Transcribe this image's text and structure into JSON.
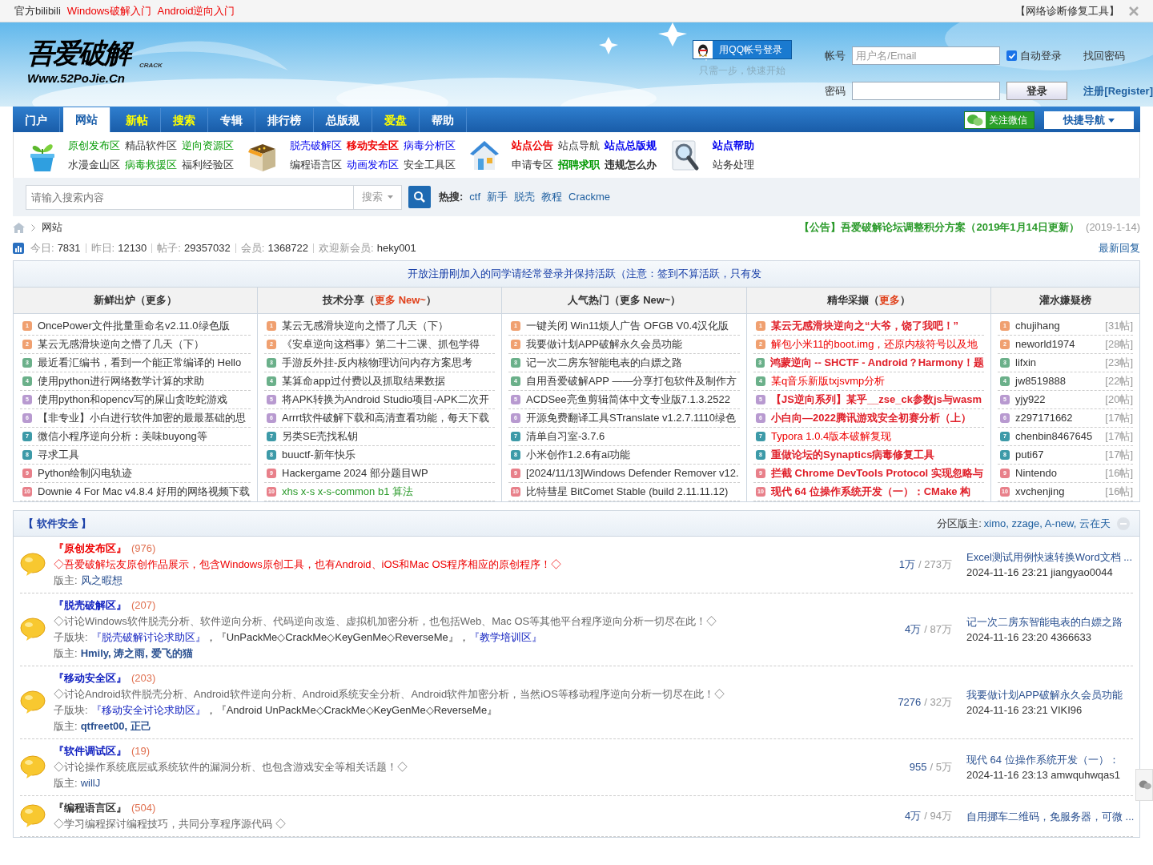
{
  "top_bar": {
    "links": [
      {
        "text": "官方bilibili",
        "kind": "plain"
      },
      {
        "text": "Windows破解入门",
        "kind": "red"
      },
      {
        "text": "Android逆向入门",
        "kind": "red"
      }
    ],
    "tool": "【网络诊断修复工具】"
  },
  "header": {
    "logo": {
      "title": "吾爱破解",
      "tag": "CRACK",
      "url": "Www.52PoJie.Cn"
    },
    "qq_button": "用QQ帐号登录",
    "qq_hint": "只需一步，快速开始",
    "account_label": "帐号",
    "account_placeholder": "用户名/Email",
    "auto_login": {
      "label": "自动登录",
      "checked": true
    },
    "forgot": "找回密码",
    "password_label": "密码",
    "login_button": "登录",
    "register": "注册[Register]"
  },
  "nav": {
    "tabs": [
      {
        "label": "门户",
        "selected": false,
        "highlight": false
      },
      {
        "label": "网站",
        "selected": true,
        "highlight": false
      },
      {
        "label": "新帖",
        "selected": false,
        "highlight": true
      },
      {
        "label": "搜索",
        "selected": false,
        "highlight": true
      },
      {
        "label": "专辑",
        "selected": false,
        "highlight": false
      },
      {
        "label": "排行榜",
        "selected": false,
        "highlight": false
      },
      {
        "label": "总版规",
        "selected": false,
        "highlight": false
      },
      {
        "label": "爱盘",
        "selected": false,
        "highlight": true
      },
      {
        "label": "帮助",
        "selected": false,
        "highlight": false
      }
    ],
    "wechat": "关注微信",
    "quick_nav": "快捷导航"
  },
  "quick_links": [
    {
      "kind": "plant",
      "rows": [
        [
          {
            "text": "原创发布区",
            "kind": "green",
            "bold": false
          },
          {
            "text": "精品软件区",
            "kind": "plain",
            "bold": false
          },
          {
            "text": "逆向资源区",
            "kind": "green",
            "bold": false
          }
        ],
        [
          {
            "text": "水漫金山区",
            "kind": "plain",
            "bold": false
          },
          {
            "text": "病毒救援区",
            "kind": "green",
            "bold": false
          },
          {
            "text": "福利经验区",
            "kind": "plain",
            "bold": false
          }
        ]
      ]
    },
    {
      "kind": "box",
      "rows": [
        [
          {
            "text": "脱壳破解区",
            "kind": "blue",
            "bold": false
          },
          {
            "text": "移动安全区",
            "kind": "red",
            "bold": true
          },
          {
            "text": "病毒分析区",
            "kind": "blue",
            "bold": false
          }
        ],
        [
          {
            "text": "编程语言区",
            "kind": "plain",
            "bold": false
          },
          {
            "text": "动画发布区",
            "kind": "blue",
            "bold": false
          },
          {
            "text": "安全工具区",
            "kind": "plain",
            "bold": false
          }
        ]
      ]
    },
    {
      "kind": "house",
      "rows": [
        [
          {
            "text": "站点公告",
            "kind": "red",
            "bold": true
          },
          {
            "text": "站点导航",
            "kind": "plain",
            "bold": false
          },
          {
            "text": "站点总版规",
            "kind": "blue",
            "bold": true
          }
        ],
        [
          {
            "text": "申请专区",
            "kind": "plain",
            "bold": false
          },
          {
            "text": "招聘求职",
            "kind": "green",
            "bold": true
          },
          {
            "text": "违规怎么办",
            "kind": "plain",
            "bold": true
          }
        ]
      ]
    },
    {
      "kind": "magnifier",
      "rows": [
        [
          {
            "text": "站点帮助",
            "kind": "blue",
            "bold": true
          }
        ],
        [
          {
            "text": "站务处理",
            "kind": "plain",
            "bold": false
          }
        ]
      ]
    }
  ],
  "search": {
    "placeholder": "请输入搜索内容",
    "scope": "搜索",
    "hot_label": "热搜:",
    "hot": [
      "ctf",
      "新手",
      "脱壳",
      "教程",
      "Crackme"
    ]
  },
  "breadcrumb": {
    "current": "网站",
    "notice": "【公告】吾爱破解论坛调整积分方案（2019年1月14日更新）",
    "notice_date": "(2019-1-14)"
  },
  "stats": {
    "items": [
      {
        "label": "今日:",
        "value": "7831"
      },
      {
        "label": "昨日:",
        "value": "12130"
      },
      {
        "label": "帖子:",
        "value": "29357032"
      },
      {
        "label": "会员:",
        "value": "1368722"
      },
      {
        "label": "欢迎新会员:",
        "value": "heky001"
      }
    ],
    "latest": "最新回复"
  },
  "announcement": "开放注册刚加入的同学请经常登录并保持活跃（注意：签到不算活跃，只有发",
  "hot_table": [
    {
      "before": "新鲜出炉（",
      "more": "更多",
      "after": "）",
      "highlight": false,
      "items": [
        {
          "rank": "1",
          "title": "OncePower文件批量重命名v2.11.0绿色版",
          "kind": "plain"
        },
        {
          "rank": "2",
          "title": "某云无感滑块逆向之懵了几天（下）",
          "kind": "plain"
        },
        {
          "rank": "3",
          "title": "最近看汇编书，看到一个能正常编译的 Hello",
          "kind": "plain"
        },
        {
          "rank": "4",
          "title": "使用python进行网络数学计算的求助",
          "kind": "plain"
        },
        {
          "rank": "5",
          "title": "使用python和opencv写的屎山贪吃蛇游戏",
          "kind": "plain"
        },
        {
          "rank": "6",
          "title": "【非专业】小白进行软件加密的最最基础的思",
          "kind": "plain"
        },
        {
          "rank": "7",
          "title": "微信小程序逆向分析：美味buyong等",
          "kind": "plain"
        },
        {
          "rank": "8",
          "title": "寻求工具",
          "kind": "plain"
        },
        {
          "rank": "9",
          "title": "Python绘制闪电轨迹",
          "kind": "plain"
        },
        {
          "rank": "10",
          "title": "Downie 4 For Mac v4.8.4 好用的网络视频下载",
          "kind": "plain"
        }
      ]
    },
    {
      "before": "技术分享（",
      "more": "更多 New~",
      "after": "）",
      "highlight": true,
      "items": [
        {
          "rank": "1",
          "title": "某云无感滑块逆向之懵了几天（下）",
          "kind": "plain"
        },
        {
          "rank": "2",
          "title": "《安卓逆向这档事》第二十二课、抓包学得",
          "kind": "plain"
        },
        {
          "rank": "3",
          "title": "手游反外挂-反内核物理访问内存方案思考",
          "kind": "plain"
        },
        {
          "rank": "4",
          "title": "某算命app过付费以及抓取结果数据",
          "kind": "plain"
        },
        {
          "rank": "5",
          "title": "将APK转换为Android Studio项目-APK二次开",
          "kind": "plain"
        },
        {
          "rank": "6",
          "title": "Arrrt软件破解下载和高清查看功能，每天下载",
          "kind": "plain"
        },
        {
          "rank": "7",
          "title": "另类SE壳找私钥",
          "kind": "plain"
        },
        {
          "rank": "8",
          "title": "buuctf-新年快乐",
          "kind": "plain"
        },
        {
          "rank": "9",
          "title": "Hackergame 2024 部分题目WP",
          "kind": "plain"
        },
        {
          "rank": "10",
          "title": "xhs x-s x-s-common b1 算法",
          "kind": "green"
        }
      ]
    },
    {
      "before": "人气热门（",
      "more": "更多 New~",
      "after": "）",
      "highlight": false,
      "items": [
        {
          "rank": "1",
          "title": "一键关闭 Win11烦人广告 OFGB V0.4汉化版",
          "kind": "plain"
        },
        {
          "rank": "2",
          "title": "我要做计划APP破解永久会员功能",
          "kind": "plain"
        },
        {
          "rank": "3",
          "title": "记一次二房东智能电表的白嫖之路",
          "kind": "plain"
        },
        {
          "rank": "4",
          "title": "自用吾爱破解APP ——分享打包软件及制作方",
          "kind": "plain"
        },
        {
          "rank": "5",
          "title": "ACDSee亮鱼剪辑简体中文专业版7.1.3.2522",
          "kind": "plain"
        },
        {
          "rank": "6",
          "title": "开源免费翻译工具STranslate v1.2.7.1110绿色",
          "kind": "plain"
        },
        {
          "rank": "7",
          "title": "清单自习室-3.7.6",
          "kind": "plain"
        },
        {
          "rank": "8",
          "title": "小米创作1.2.6有ai功能",
          "kind": "plain"
        },
        {
          "rank": "9",
          "title": "[2024/11/13]Windows Defender Remover v12.",
          "kind": "plain"
        },
        {
          "rank": "10",
          "title": "比特彗星 BitComet Stable (build 2.11.11.12)",
          "kind": "plain"
        }
      ]
    },
    {
      "before": "精华采撷（",
      "more": "更多",
      "after": "）",
      "highlight": true,
      "items": [
        {
          "rank": "1",
          "title": "某云无感滑块逆向之“大爷，饶了我吧！”",
          "kind": "red-bold"
        },
        {
          "rank": "2",
          "title": "解包小米11的boot.img，还原内核符号以及地",
          "kind": "red"
        },
        {
          "rank": "3",
          "title": "鸿蒙逆向 -- SHCTF - Android？Harmony！题",
          "kind": "red-bold"
        },
        {
          "rank": "4",
          "title": "某q音乐新版txjsvmp分析",
          "kind": "red"
        },
        {
          "rank": "5",
          "title": "【JS逆向系列】某乎__zse_ck参数js与wasm",
          "kind": "red-bold"
        },
        {
          "rank": "6",
          "title": "小白向—2022腾讯游戏安全初赛分析（上）",
          "kind": "red-bold"
        },
        {
          "rank": "7",
          "title": "Typora 1.0.4版本破解复现",
          "kind": "red"
        },
        {
          "rank": "8",
          "title": "重做论坛的Synaptics病毒修复工具",
          "kind": "red-bold"
        },
        {
          "rank": "9",
          "title": "拦截 Chrome DevTools Protocol 实现忽略与",
          "kind": "red-bold"
        },
        {
          "rank": "10",
          "title": "现代 64 位操作系统开发（一）：CMake 构",
          "kind": "red-bold"
        }
      ]
    },
    {
      "before": "灌水嫌疑榜",
      "items": [
        {
          "rank": "1",
          "title": "chujihang",
          "count": "[31帖]",
          "kind": "plain"
        },
        {
          "rank": "2",
          "title": "neworld1974",
          "count": "[28帖]",
          "kind": "plain"
        },
        {
          "rank": "3",
          "title": "lifxin",
          "count": "[23帖]",
          "kind": "plain"
        },
        {
          "rank": "4",
          "title": "jw8519888",
          "count": "[22帖]",
          "kind": "plain"
        },
        {
          "rank": "5",
          "title": "yjy922",
          "count": "[20帖]",
          "kind": "plain"
        },
        {
          "rank": "6",
          "title": "z297171662",
          "count": "[17帖]",
          "kind": "plain"
        },
        {
          "rank": "7",
          "title": "chenbin8467645",
          "count": "[17帖]",
          "kind": "plain"
        },
        {
          "rank": "8",
          "title": "puti67",
          "count": "[17帖]",
          "kind": "plain"
        },
        {
          "rank": "9",
          "title": "Nintendo",
          "count": "[16帖]",
          "kind": "plain"
        },
        {
          "rank": "10",
          "title": "xvchenjing",
          "count": "[16帖]",
          "kind": "plain"
        }
      ]
    }
  ],
  "section": {
    "title": "【 软件安全 】",
    "moderators_label": "分区版主:",
    "moderators": "ximo, zzage, A-new, 云在天",
    "expanded": true,
    "forums": [
      {
        "name": "『原创发布区』",
        "kind": "red",
        "count": "(976)",
        "description": "◇吾爱破解坛友原创作品展示，包含Windows原创工具，也有Android、iOS和Mac OS程序相应的原创程序！◇",
        "moderators_label": "版主:",
        "moderators": "风之暇想",
        "moderators_bold": false,
        "today": "1万",
        "total": "/ 273万",
        "last_title": "Excel测试用例快速转换Word文档 ...",
        "last_meta": "2024-11-16 23:21 jiangyao0044"
      },
      {
        "name": "『脱壳破解区』",
        "kind": "blue",
        "count": "(207)",
        "description": "◇讨论Windows软件脱壳分析、软件逆向分析、代码逆向改造、虚拟机加密分析，也包括Web、Mac OS等其他平台程序逆向分析一切尽在此！◇",
        "subforums_label": "子版块:",
        "subforums": [
          {
            "text": "『脱壳破解讨论求助区』",
            "link": true
          },
          {
            "text": "，",
            "link": false
          },
          {
            "text": "『UnPackMe◇CrackMe◇KeyGenMe◇ReverseMe』",
            "link": false
          },
          {
            "text": "，",
            "link": false
          },
          {
            "text": "『教学培训区』",
            "link": true
          }
        ],
        "moderators_label": "版主:",
        "moderators": "Hmily, 涛之雨, 爱飞的猫",
        "moderators_bold": true,
        "today": "4万",
        "total": "/ 87万",
        "last_title": "记一次二房东智能电表的白嫖之路",
        "last_meta": "2024-11-16 23:20 4366633"
      },
      {
        "name": "『移动安全区』",
        "kind": "blue",
        "count": "(203)",
        "description": "◇讨论Android软件脱壳分析、Android软件逆向分析、Android系统安全分析、Android软件加密分析，当然iOS等移动程序逆向分析一切尽在此！◇",
        "subforums_label": "子版块:",
        "subforums": [
          {
            "text": "『移动安全讨论求助区』",
            "link": true
          },
          {
            "text": "，",
            "link": false
          },
          {
            "text": "『Android UnPackMe◇CrackMe◇KeyGenMe◇ReverseMe』",
            "link": false
          }
        ],
        "moderators_label": "版主:",
        "moderators": "qtfreet00, 正己",
        "moderators_bold": true,
        "today": "7276",
        "total": "/ 32万",
        "last_title": "我要做计划APP破解永久会员功能",
        "last_meta": "2024-11-16 23:21 VIKI96"
      },
      {
        "name": "『软件调试区』",
        "kind": "blue",
        "count": "(19)",
        "description": "◇讨论操作系统底层或系统软件的漏洞分析、也包含游戏安全等相关话题！◇",
        "moderators_label": "版主:",
        "moderators": "willJ",
        "moderators_bold": false,
        "today": "955",
        "total": "/ 5万",
        "last_title": "现代 64 位操作系统开发（一）：",
        "last_meta": "2024-11-16 23:13 amwquhwqas1"
      },
      {
        "name": "『编程语言区』",
        "kind": "plain",
        "count": "(504)",
        "description": "◇学习编程探讨编程技巧，共同分享程序源代码 ◇",
        "today": "4万",
        "total": "/ 94万",
        "last_title": "自用挪车二维码，免服务器，可微 ..."
      }
    ]
  }
}
